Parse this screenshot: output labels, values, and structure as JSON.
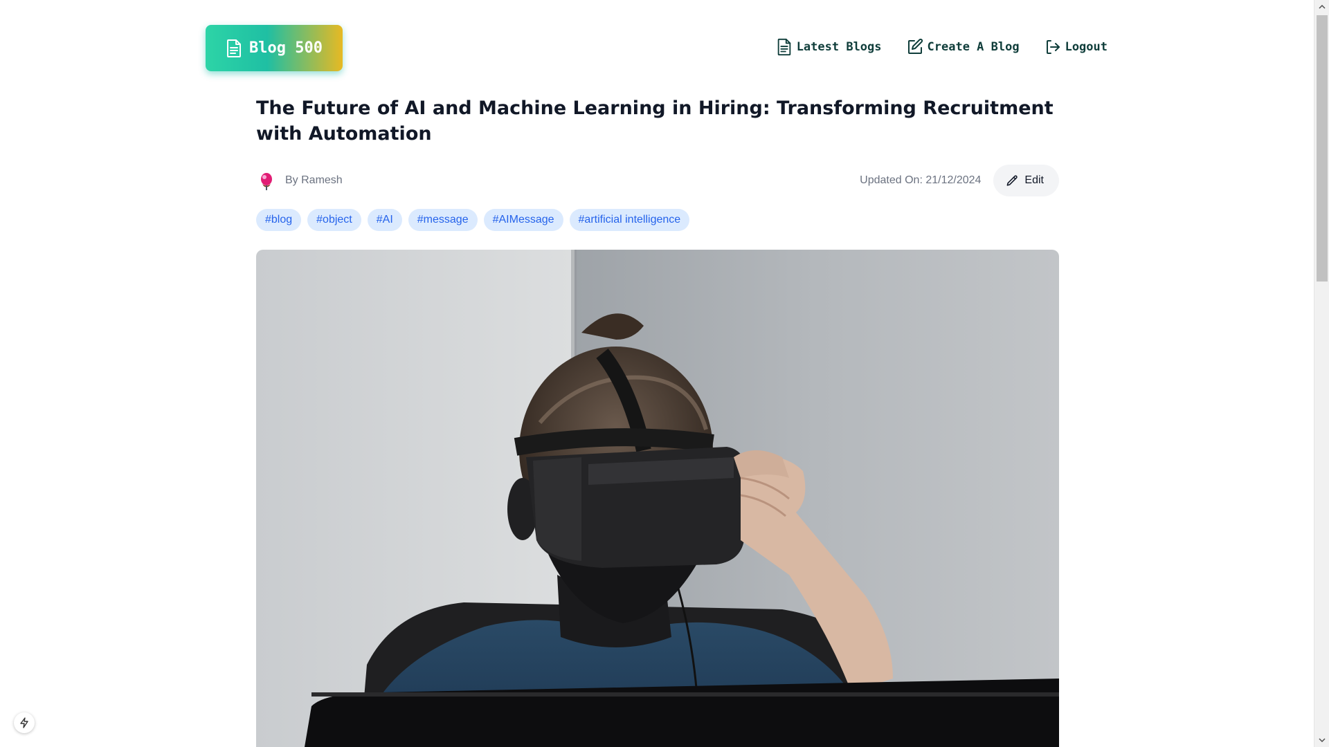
{
  "brand": {
    "label": "Blog 500",
    "icon": "document-icon"
  },
  "nav": {
    "latest": {
      "label": "Latest Blogs",
      "icon": "document-icon"
    },
    "create": {
      "label": "Create A Blog",
      "icon": "edit-square-icon"
    },
    "logout": {
      "label": "Logout",
      "icon": "logout-icon"
    }
  },
  "article": {
    "title": "The Future of AI and Machine Learning in Hiring: Transforming Recruitment with Automation",
    "author": "By Ramesh",
    "updated": "Updated On: 21/12/2024",
    "edit_label": "Edit",
    "tags": [
      "#blog",
      "#object",
      "#AI",
      "#message",
      "#AIMessage",
      "#artificial intelligence"
    ],
    "image_alt": "Person wearing a VR headset and a black face mask"
  },
  "colors": {
    "brand_gradient_start": "#2dd4a7",
    "brand_gradient_end": "#e7b923",
    "nav_text": "#0f3d3a",
    "tag_bg": "#dbeafe",
    "tag_text": "#2563eb"
  }
}
